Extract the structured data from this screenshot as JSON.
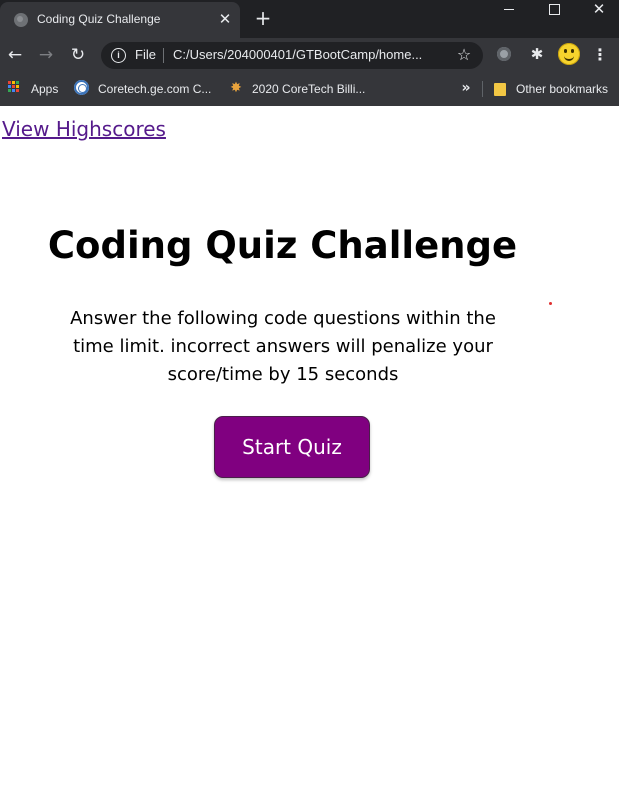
{
  "browser": {
    "tab": {
      "title": "Coding Quiz Challenge",
      "close_glyph": "✕",
      "favicon": "globe-icon"
    },
    "new_tab_glyph": "+",
    "window_close_glyph": "✕",
    "nav": {
      "back": "←",
      "forward": "→",
      "reload": "↻"
    },
    "omnibox": {
      "scheme_label": "File",
      "url": "C:/Users/204000401/GTBootCamp/home...",
      "info_glyph": "i",
      "star_glyph": "☆"
    },
    "extensions": [
      "record-icon",
      "puzzle-icon"
    ],
    "menu_glyph": "⋮",
    "bookmarks": {
      "apps_label": "Apps",
      "items": [
        {
          "label": "Coretech.ge.com C...",
          "icon": "ge-logo-icon"
        },
        {
          "label": "2020 CoreTech Billi...",
          "icon": "sparkle-icon"
        }
      ],
      "overflow_glyph": "»",
      "other_label": "Other bookmarks"
    }
  },
  "page": {
    "highscores_link": "View Highscores",
    "title": "Coding Quiz Challenge",
    "description": "Answer the following code questions within the time limit. incorrect answers will penalize your score/time by 15 seconds",
    "start_button": "Start Quiz"
  },
  "colors": {
    "chrome_dark": "#202124",
    "chrome_toolbar": "#35363a",
    "link_visited": "#551a8b",
    "start_button_bg": "#800080"
  }
}
